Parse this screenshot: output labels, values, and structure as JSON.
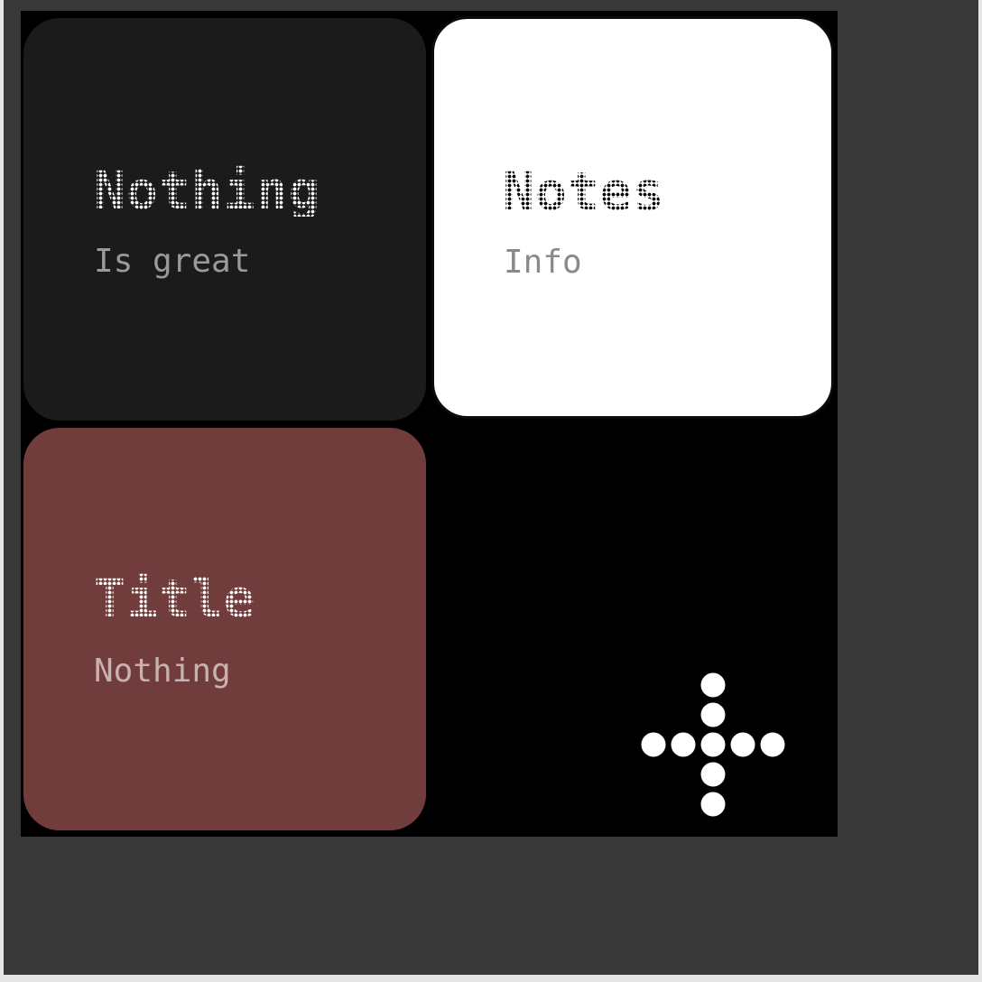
{
  "colors": {
    "outer_background": "#383838",
    "board_background": "#000000",
    "dot_white": "#ffffff",
    "dot_black": "#000000"
  },
  "cards": [
    {
      "title": "Nothing",
      "subtitle": "Is great",
      "background": "#1b1b1b",
      "subtitle_color": "#9a9a9a"
    },
    {
      "title": "Notes",
      "subtitle": "Info",
      "background": "#ffffff",
      "subtitle_color": "#8a8a8a"
    },
    {
      "title": "Title",
      "subtitle": "Nothing",
      "background": "#713c3c",
      "subtitle_color": "#c8b1b1"
    }
  ],
  "add_button": {
    "icon": "plus-dotted-icon",
    "color": "#ffffff"
  }
}
